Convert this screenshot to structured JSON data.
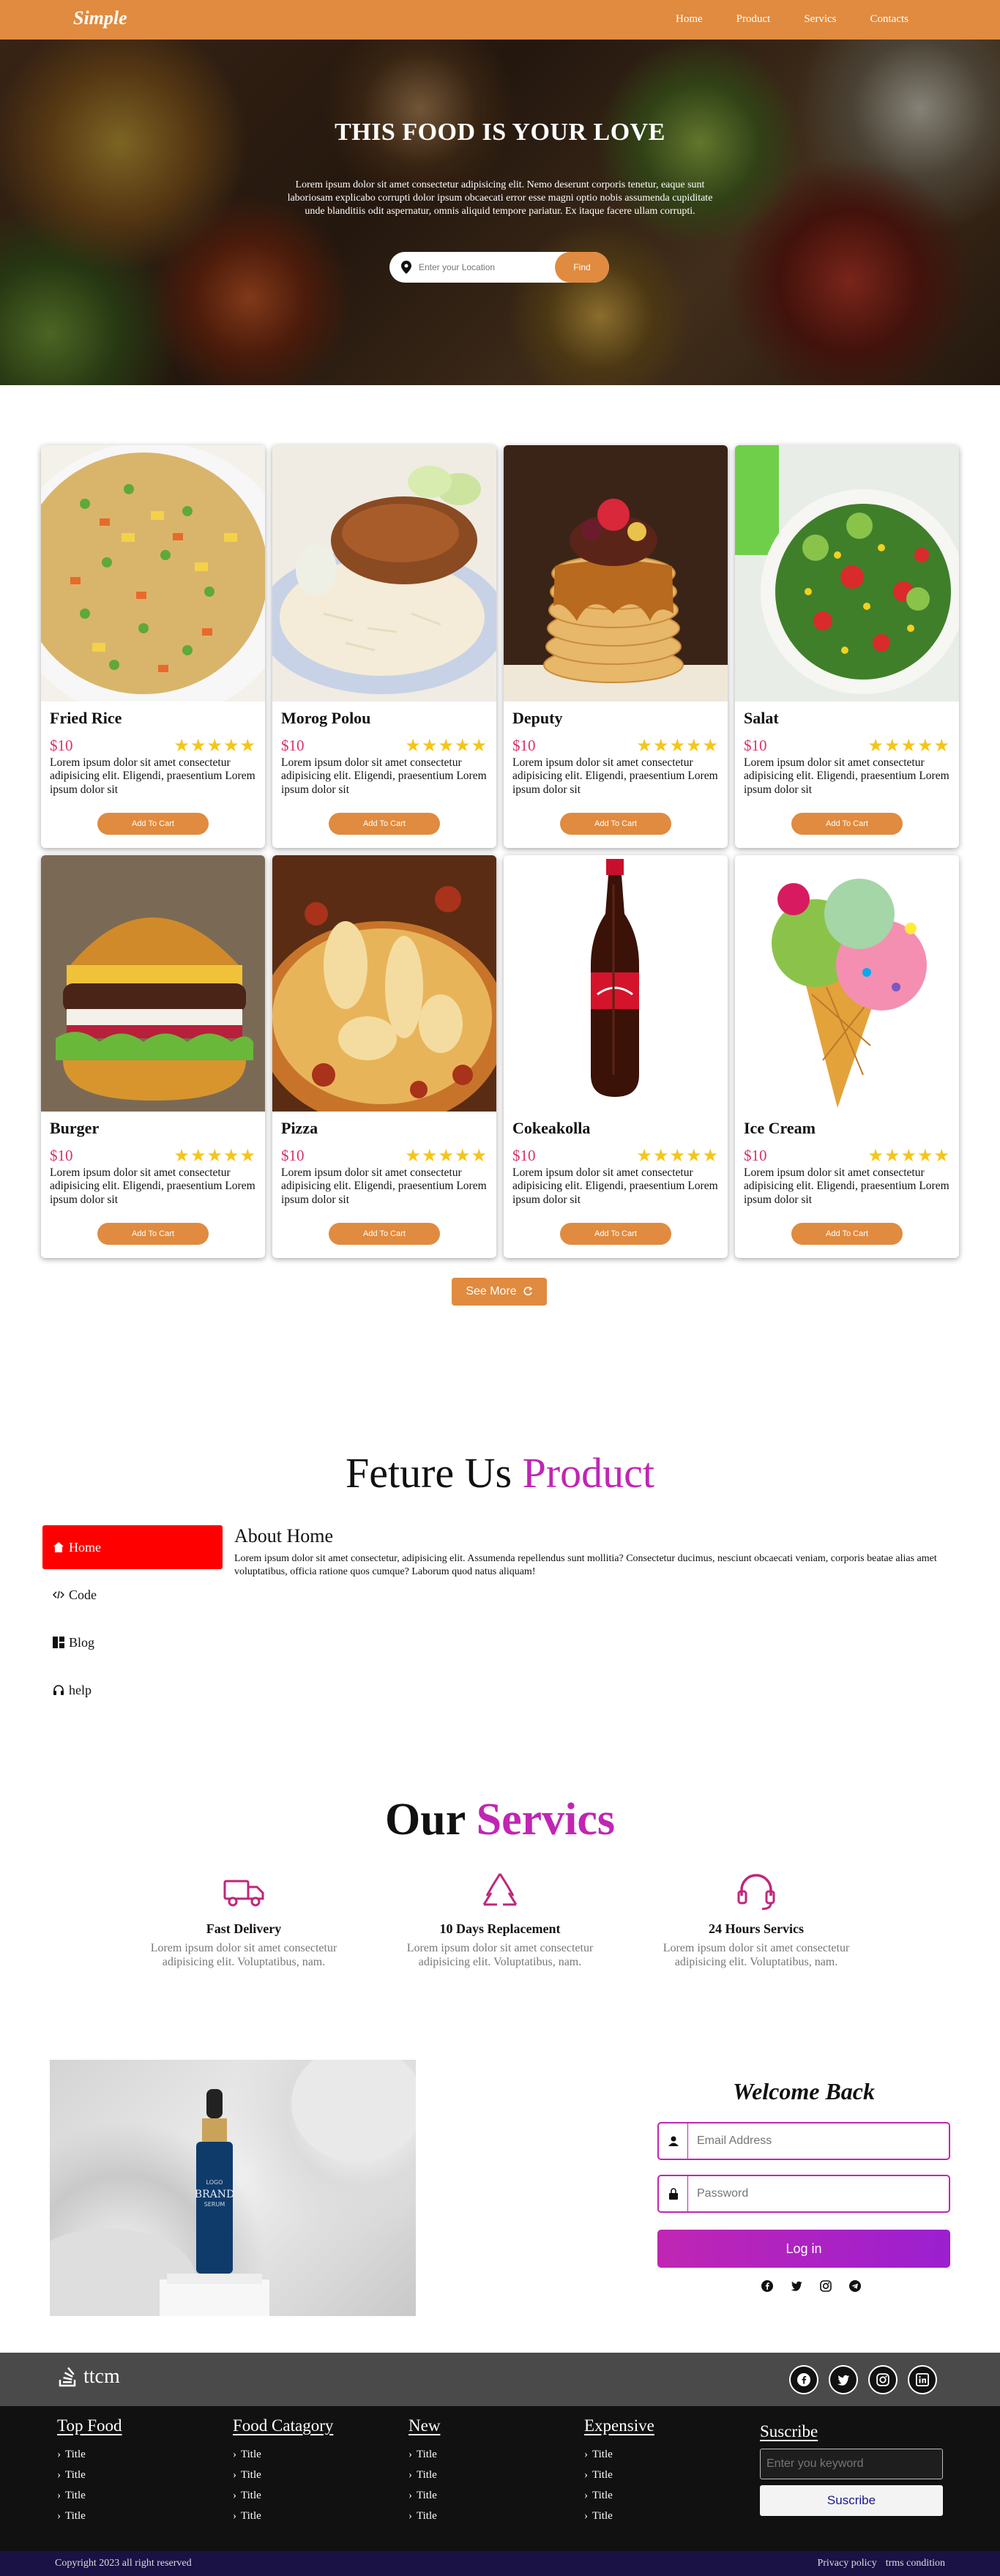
{
  "nav": {
    "brand": "Simple",
    "links": [
      "Home",
      "Product",
      "Servics",
      "Contacts"
    ]
  },
  "hero": {
    "title": "THIS FOOD IS YOUR LOVE",
    "text": "Lorem ipsum dolor sit amet consectetur adipisicing elit. Nemo deserunt corporis tenetur, eaque sunt laboriosam explicabo corrupti dolor ipsum obcaecati error esse magni optio nobis assumenda cupiditate unde blanditiis odit aspernatur, omnis aliquid tempore pariatur. Ex itaque facere ullam corrupti.",
    "search_placeholder": "Enter your Location",
    "find_label": "Find"
  },
  "products": {
    "items": [
      {
        "name": "Fried Rice",
        "price": "$10",
        "rating": 5,
        "desc": "Lorem ipsum dolor sit amet consectetur adipisicing elit. Eligendi, praesentium Lorem ipsum dolor sit",
        "cart": "Add To Cart"
      },
      {
        "name": "Morog Polou",
        "price": "$10",
        "rating": 5,
        "desc": "Lorem ipsum dolor sit amet consectetur adipisicing elit. Eligendi, praesentium Lorem ipsum dolor sit",
        "cart": "Add To Cart"
      },
      {
        "name": "Deputy",
        "price": "$10",
        "rating": 5,
        "desc": "Lorem ipsum dolor sit amet consectetur adipisicing elit. Eligendi, praesentium Lorem ipsum dolor sit",
        "cart": "Add To Cart"
      },
      {
        "name": "Salat",
        "price": "$10",
        "rating": 5,
        "desc": "Lorem ipsum dolor sit amet consectetur adipisicing elit. Eligendi, praesentium Lorem ipsum dolor sit",
        "cart": "Add To Cart"
      },
      {
        "name": "Burger",
        "price": "$10",
        "rating": 5,
        "desc": "Lorem ipsum dolor sit amet consectetur adipisicing elit. Eligendi, praesentium Lorem ipsum dolor sit",
        "cart": "Add To Cart"
      },
      {
        "name": "Pizza",
        "price": "$10",
        "rating": 5,
        "desc": "Lorem ipsum dolor sit amet consectetur adipisicing elit. Eligendi, praesentium Lorem ipsum dolor sit",
        "cart": "Add To Cart"
      },
      {
        "name": "Cokeakolla",
        "price": "$10",
        "rating": 5,
        "desc": "Lorem ipsum dolor sit amet consectetur adipisicing elit. Eligendi, praesentium Lorem ipsum dolor sit",
        "cart": "Add To Cart"
      },
      {
        "name": "Ice Cream",
        "price": "$10",
        "rating": 5,
        "desc": "Lorem ipsum dolor sit amet consectetur adipisicing elit. Eligendi, praesentium Lorem ipsum dolor sit",
        "cart": "Add To Cart"
      }
    ],
    "see_more": "See More"
  },
  "feature": {
    "title_a": "Feture Us",
    "title_b": "Product",
    "tabs": [
      "Home",
      "Code",
      "Blog",
      "help"
    ],
    "about_title": "About Home",
    "about_text": "Lorem ipsum dolor sit amet consectetur, adipisicing elit. Assumenda repellendus sunt mollitia? Consectetur ducimus, nesciunt obcaecati veniam, corporis beatae alias amet voluptatibus, officia ratione quos cumque? Laborum quod natus aliquam!"
  },
  "services": {
    "title_a": "Our",
    "title_b": "Servics",
    "items": [
      {
        "icon": "truck-icon",
        "title": "Fast Delivery",
        "desc": "Lorem ipsum dolor sit amet consectetur adipisicing elit. Voluptatibus, nam."
      },
      {
        "icon": "recycle-icon",
        "title": "10 Days Replacement",
        "desc": "Lorem ipsum dolor sit amet consectetur adipisicing elit. Voluptatibus, nam."
      },
      {
        "icon": "headset-icon",
        "title": "24 Hours Servics",
        "desc": "Lorem ipsum dolor sit amet consectetur adipisicing elit. Voluptatibus, nam."
      }
    ]
  },
  "login": {
    "title": "Welcome Back",
    "email_placeholder": "Email Address",
    "password_placeholder": "Password",
    "button": "Log in",
    "product_brand": "BRAND",
    "product_top": "LOGO",
    "product_sub": "SERUM"
  },
  "footer": {
    "logo": "ttcm",
    "columns": [
      {
        "heading": "Top Food",
        "items": [
          "Title",
          "Title",
          "Title",
          "Title"
        ]
      },
      {
        "heading": "Food Catagory",
        "items": [
          "Title",
          "Title",
          "Title",
          "Title"
        ]
      },
      {
        "heading": "New",
        "items": [
          "Title",
          "Title",
          "Title",
          "Title"
        ]
      },
      {
        "heading": "Expensive",
        "items": [
          "Title",
          "Title",
          "Title",
          "Title"
        ]
      }
    ],
    "subscribe": {
      "heading": "Suscribe",
      "placeholder": "Enter you keyword",
      "button": "Suscribe"
    },
    "copyright": "Copyright 2023   all right reserved",
    "links": [
      "Privacy policy",
      "trms condition"
    ]
  },
  "colors": {
    "accent": "#e08b3f",
    "purple": "#c026b3",
    "price": "#d6336c",
    "active_tab": "#ff0000"
  }
}
